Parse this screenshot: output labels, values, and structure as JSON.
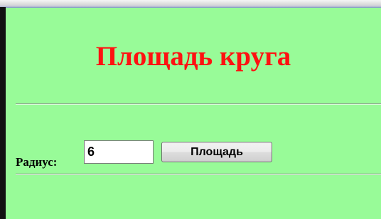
{
  "page": {
    "title": "Площадь круга"
  },
  "form": {
    "radius_label": "Радиус:",
    "radius_value": "6",
    "area_button_label": "Площадь"
  },
  "colors": {
    "background": "#98fb98",
    "title": "#ff1111"
  }
}
